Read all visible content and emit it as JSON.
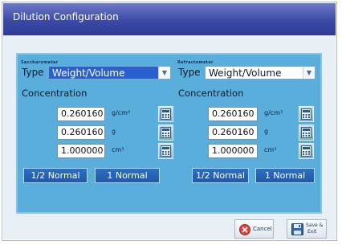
{
  "window": {
    "title": "Dilution Configuration"
  },
  "saccharometer": {
    "group_title": "Saccharometer",
    "type_label": "Type",
    "type_value": "Weight/Volume",
    "concentration_label": "Concentration",
    "rows": [
      {
        "value": "0.260160",
        "unit": "g/cm³"
      },
      {
        "value": "0.260160",
        "unit": "g"
      },
      {
        "value": "1.000000",
        "unit": "cm³"
      }
    ],
    "half_normal_label": "1/2 Normal",
    "normal_label": "1 Normal"
  },
  "refractometer": {
    "group_title": "Refractometer",
    "type_label": "Type",
    "type_value": "Weight/Volume",
    "concentration_label": "Concentration",
    "rows": [
      {
        "value": "0.260160",
        "unit": "g/cm³"
      },
      {
        "value": "0.260160",
        "unit": "g"
      },
      {
        "value": "1.000000",
        "unit": "cm³"
      }
    ],
    "half_normal_label": "1/2 Normal",
    "normal_label": "1 Normal"
  },
  "footer": {
    "cancel_label": "Cancel",
    "save_exit_label_line1": "Save &",
    "save_exit_label_line2": "Exit"
  },
  "icons": {
    "calculator": "calculator-icon",
    "cancel": "cancel-x-icon",
    "save": "floppy-disk-icon",
    "dropdown": "chevron-down-icon"
  },
  "colors": {
    "titlebar": "#3c4aa6",
    "panel": "#5aaedc",
    "normal_button": "#2466b8",
    "selected_type": "#2a5fd0"
  }
}
